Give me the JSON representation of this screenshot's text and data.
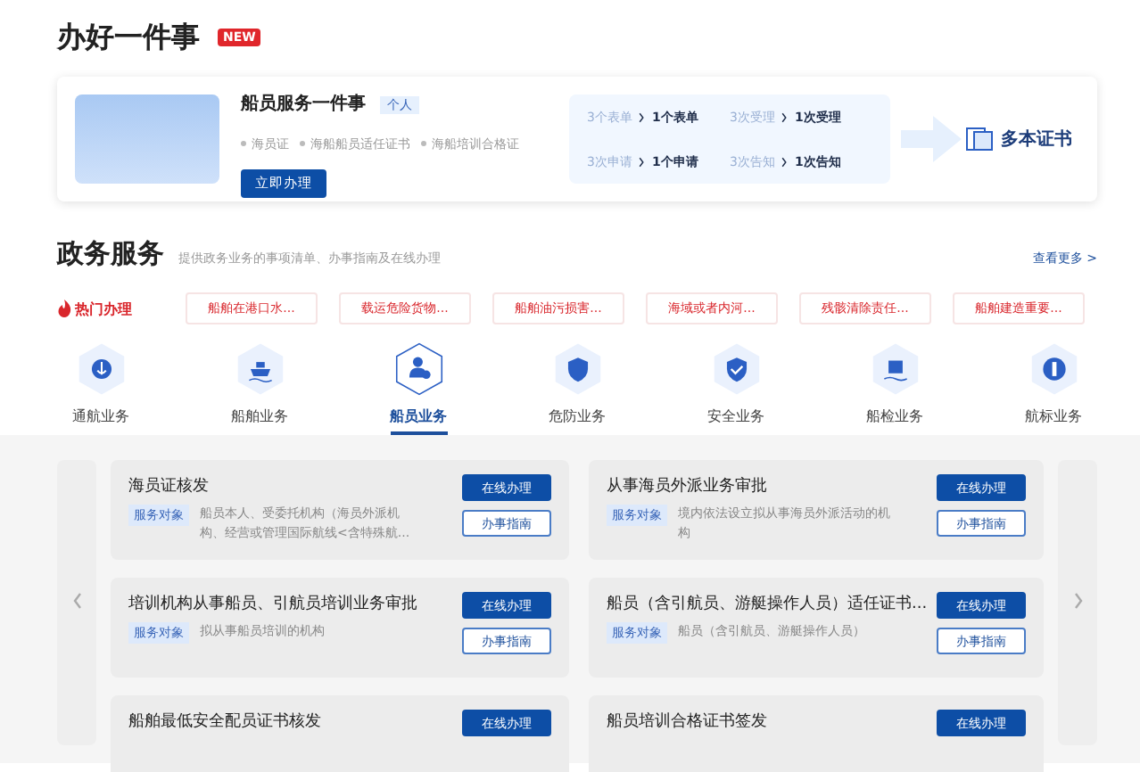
{
  "header": {
    "title": "办好一件事",
    "badge": "NEW"
  },
  "feature": {
    "title": "船员服务一件事",
    "tag": "个人",
    "bullets": [
      "海员证",
      "海船船员适任证书",
      "海船培训合格证"
    ],
    "button": "立即办理",
    "flow": [
      {
        "before": "3个表单",
        "after": "1个表单"
      },
      {
        "before": "3次受理",
        "after": "1次受理"
      },
      {
        "before": "3次申请",
        "after": "1个申请"
      },
      {
        "before": "3次告知",
        "after": "1次告知"
      }
    ],
    "result": "多本证书"
  },
  "section": {
    "title": "政务服务",
    "subtitle": "提供政务业务的事项清单、办事指南及在线办理",
    "more": "查看更多 >"
  },
  "hot": {
    "label": "热门办理",
    "items": [
      "船舶在港口水...",
      "载运危险货物...",
      "船舶油污损害...",
      "海域或者内河...",
      "残骸清除责任...",
      "船舶建造重要..."
    ]
  },
  "categories": [
    {
      "label": "通航业务",
      "selected": false,
      "kind": "anchor"
    },
    {
      "label": "船舶业务",
      "selected": false,
      "kind": "ship"
    },
    {
      "label": "船员业务",
      "selected": true,
      "kind": "crew"
    },
    {
      "label": "危防业务",
      "selected": false,
      "kind": "hazard"
    },
    {
      "label": "安全业务",
      "selected": false,
      "kind": "safety"
    },
    {
      "label": "船检业务",
      "selected": false,
      "kind": "inspect"
    },
    {
      "label": "航标业务",
      "selected": false,
      "kind": "beacon"
    }
  ],
  "services": [
    {
      "title": "海员证核发",
      "target_label": "服务对象",
      "target": "船员本人、受委托机构（海员外派机构、经营或管理国际航线<含特殊航...",
      "online": "在线办理",
      "guide": "办事指南"
    },
    {
      "title": "从事海员外派业务审批",
      "target_label": "服务对象",
      "target": "境内依法设立拟从事海员外派活动的机构",
      "online": "在线办理",
      "guide": "办事指南"
    },
    {
      "title": "培训机构从事船员、引航员培训业务审批",
      "target_label": "服务对象",
      "target": "拟从事船员培训的机构",
      "online": "在线办理",
      "guide": "办事指南"
    },
    {
      "title": "船员（含引航员、游艇操作人员）适任证书...",
      "target_label": "服务对象",
      "target": "船员（含引航员、游艇操作人员）",
      "online": "在线办理",
      "guide": "办事指南"
    },
    {
      "title": "船舶最低安全配员证书核发",
      "online": "在线办理"
    },
    {
      "title": "船员培训合格证书签发",
      "online": "在线办理"
    }
  ]
}
